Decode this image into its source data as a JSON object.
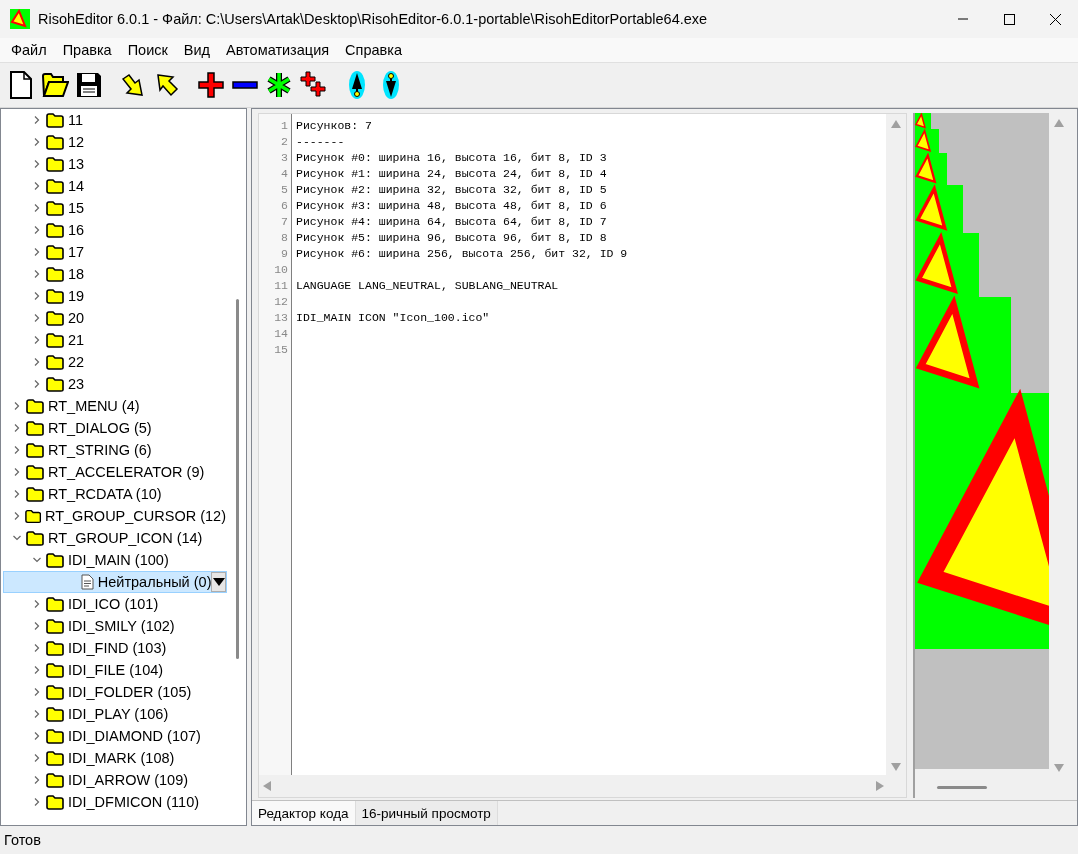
{
  "window": {
    "title": "RisohEditor 6.0.1 - Файл: C:\\Users\\Artak\\Desktop\\RisohEditor-6.0.1-portable\\RisohEditorPortable64.exe"
  },
  "menu": [
    "Файл",
    "Правка",
    "Поиск",
    "Вид",
    "Автоматизация",
    "Справка"
  ],
  "tree": [
    {
      "children": [
        {
          "label": "11",
          "expanded": false,
          "selected": false
        },
        {
          "label": "12",
          "expanded": false,
          "selected": false
        },
        {
          "label": "13",
          "expanded": false,
          "selected": false
        },
        {
          "label": "14",
          "expanded": false,
          "selected": false
        },
        {
          "label": "15",
          "expanded": false,
          "selected": false
        },
        {
          "label": "16",
          "expanded": false,
          "selected": false
        },
        {
          "label": "17",
          "expanded": false,
          "selected": false
        },
        {
          "label": "18",
          "expanded": false,
          "selected": false
        },
        {
          "label": "19",
          "expanded": false,
          "selected": false
        },
        {
          "label": "20",
          "expanded": false,
          "selected": false
        },
        {
          "label": "21",
          "expanded": false,
          "selected": false
        },
        {
          "label": "22",
          "expanded": false,
          "selected": false
        },
        {
          "label": "23",
          "expanded": false,
          "selected": false
        }
      ]
    },
    {
      "label": "RT_MENU (4)",
      "expanded": false,
      "selected": false
    },
    {
      "label": "RT_DIALOG (5)",
      "expanded": false,
      "selected": false
    },
    {
      "label": "RT_STRING (6)",
      "expanded": false,
      "selected": false
    },
    {
      "label": "RT_ACCELERATOR (9)",
      "expanded": false,
      "selected": false
    },
    {
      "label": "RT_RCDATA (10)",
      "expanded": false,
      "selected": false
    },
    {
      "label": "RT_GROUP_CURSOR (12)",
      "expanded": false,
      "selected": false
    },
    {
      "label": "RT_GROUP_ICON (14)",
      "expanded": true,
      "selected": false,
      "children": [
        {
          "label": "IDI_MAIN (100)",
          "expanded": true,
          "selected": false,
          "children": [
            {
              "label": "Нейтральный (0)",
              "kind": "file",
              "selected": true
            }
          ]
        },
        {
          "label": "IDI_ICO (101)",
          "expanded": false,
          "selected": false
        },
        {
          "label": "IDI_SMILY (102)",
          "expanded": false,
          "selected": false
        },
        {
          "label": "IDI_FIND (103)",
          "expanded": false,
          "selected": false
        },
        {
          "label": "IDI_FILE (104)",
          "expanded": false,
          "selected": false
        },
        {
          "label": "IDI_FOLDER (105)",
          "expanded": false,
          "selected": false
        },
        {
          "label": "IDI_PLAY (106)",
          "expanded": false,
          "selected": false
        },
        {
          "label": "IDI_DIAMOND (107)",
          "expanded": false,
          "selected": false
        },
        {
          "label": "IDI_MARK (108)",
          "expanded": false,
          "selected": false
        },
        {
          "label": "IDI_ARROW (109)",
          "expanded": false,
          "selected": false
        },
        {
          "label": "IDI_DFMICON (110)",
          "expanded": false,
          "selected": false
        }
      ]
    }
  ],
  "editor": {
    "lines": [
      {
        "number": "1",
        "text": "Рисунков: 7"
      },
      {
        "number": "2",
        "text": "-------"
      },
      {
        "number": "3",
        "text": "Рисунок #0: ширина 16, высота 16, бит 8, ID 3"
      },
      {
        "number": "4",
        "text": "Рисунок #1: ширина 24, высота 24, бит 8, ID 4"
      },
      {
        "number": "5",
        "text": "Рисунок #2: ширина 32, высота 32, бит 8, ID 5"
      },
      {
        "number": "6",
        "text": "Рисунок #3: ширина 48, высота 48, бит 8, ID 6"
      },
      {
        "number": "7",
        "text": "Рисунок #4: ширина 64, высота 64, бит 8, ID 7"
      },
      {
        "number": "8",
        "text": "Рисунок #5: ширина 96, высота 96, бит 8, ID 8"
      },
      {
        "number": "9",
        "text": "Рисунок #6: ширина 256, высота 256, бит 32, ID 9"
      },
      {
        "number": "10"
      },
      {
        "number": "11",
        "text": "LANGUAGE LANG_NEUTRAL, SUBLANG_NEUTRAL"
      },
      {
        "number": "12"
      },
      {
        "number": "13",
        "text": "IDI_MAIN ICON \"Icon_100.ico\""
      },
      {
        "number": "14"
      },
      {
        "number": "15"
      }
    ]
  },
  "tabs": [
    {
      "label": "Редактор кода",
      "selected": true
    },
    {
      "label": "16-ричный просмотр",
      "selected": false
    }
  ],
  "status_bar": "Готов"
}
